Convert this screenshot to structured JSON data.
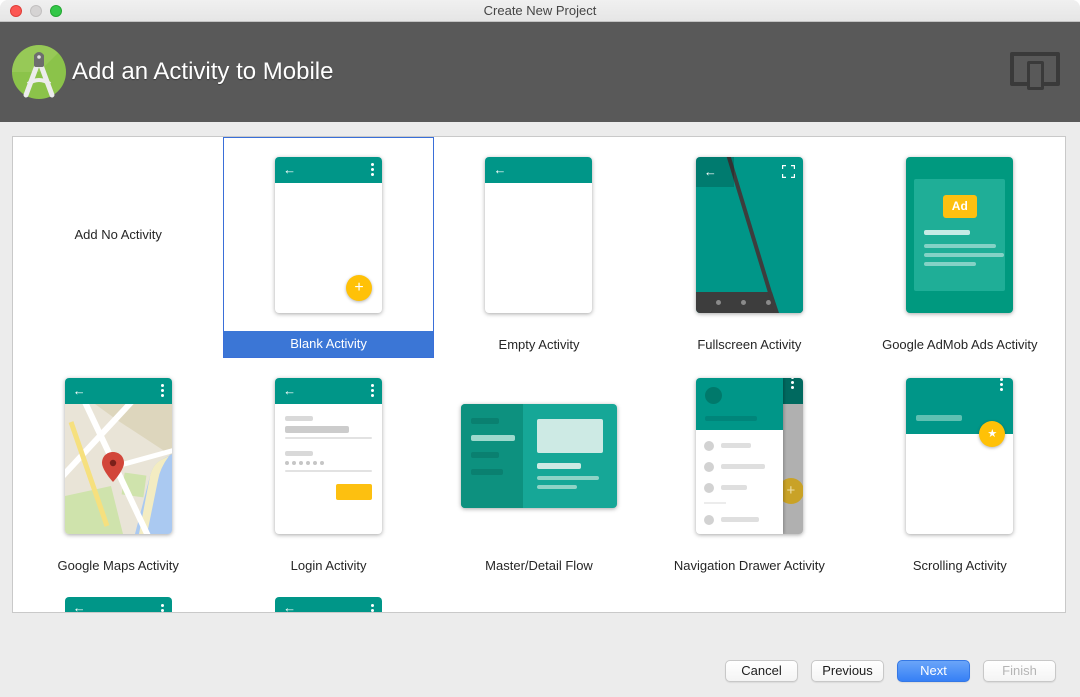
{
  "window": {
    "title": "Create New Project",
    "traffic_lights": [
      "close",
      "minimize",
      "zoom"
    ]
  },
  "header": {
    "title": "Add an Activity to Mobile",
    "logo": "android-studio-logo",
    "device_icon": "desktop-and-phone-icon"
  },
  "icons": {
    "back_arrow": "←",
    "overflow_menu": "⋮",
    "plus": "+",
    "star": "★"
  },
  "thumbnail_text": {
    "ad_badge": "Ad"
  },
  "gallery": {
    "items": [
      {
        "label": "Add No Activity",
        "type": "none",
        "selected": false
      },
      {
        "label": "Blank Activity",
        "type": "blank",
        "selected": true
      },
      {
        "label": "Empty Activity",
        "type": "empty",
        "selected": false
      },
      {
        "label": "Fullscreen Activity",
        "type": "fullscreen",
        "selected": false
      },
      {
        "label": "Google AdMob Ads Activity",
        "type": "admob",
        "selected": false
      },
      {
        "label": "Google Maps Activity",
        "type": "maps",
        "selected": false
      },
      {
        "label": "Login Activity",
        "type": "login",
        "selected": false
      },
      {
        "label": "Master/Detail Flow",
        "type": "master-detail",
        "selected": false
      },
      {
        "label": "Navigation Drawer Activity",
        "type": "nav-drawer",
        "selected": false
      },
      {
        "label": "Scrolling Activity",
        "type": "scrolling",
        "selected": false
      },
      {
        "type": "partial",
        "selected": false
      },
      {
        "type": "partial",
        "selected": false
      }
    ]
  },
  "footer": {
    "buttons": [
      {
        "label": "Cancel",
        "enabled": true,
        "primary": false
      },
      {
        "label": "Previous",
        "enabled": true,
        "primary": false
      },
      {
        "label": "Next",
        "enabled": true,
        "primary": true
      },
      {
        "label": "Finish",
        "enabled": false,
        "primary": false
      }
    ]
  },
  "colors": {
    "teal": "#009688",
    "teal_dark": "#00796b",
    "amber": "#ffc107",
    "selection_blue": "#3b76d6",
    "header_gray": "#595959"
  }
}
